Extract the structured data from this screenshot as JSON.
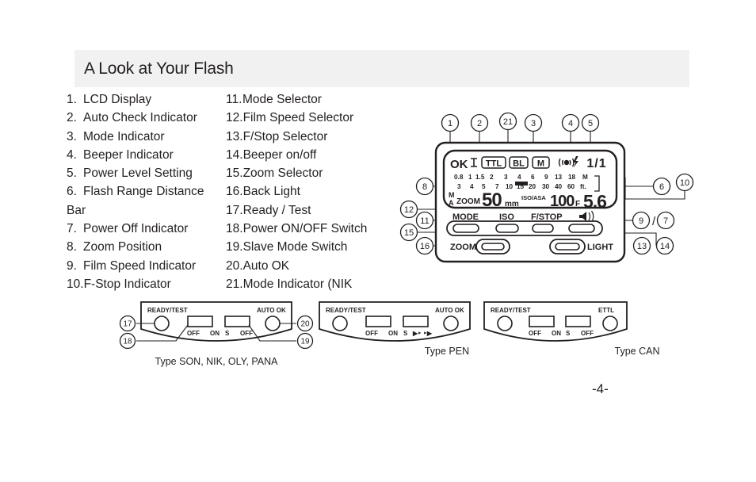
{
  "header": {
    "title": "A Look at Your Flash"
  },
  "page": {
    "number": "-4-"
  },
  "list_left": [
    {
      "num": "1.",
      "label": "LCD Display"
    },
    {
      "num": "2.",
      "label": "Auto Check Indicator"
    },
    {
      "num": "3.",
      "label": "Mode Indicator"
    },
    {
      "num": "4.",
      "label": "Beeper Indicator"
    },
    {
      "num": "5.",
      "label": "Power Level Setting"
    },
    {
      "num": "6.",
      "label": "Flash Range Distance"
    },
    {
      "num": "",
      "label": "Bar"
    },
    {
      "num": "7.",
      "label": "Power Off Indicator"
    },
    {
      "num": "8.",
      "label": "Zoom Position"
    },
    {
      "num": "9.",
      "label": "Film Speed Indicator"
    },
    {
      "num": "10.",
      "label": "F-Stop Indicator"
    }
  ],
  "list_right": [
    {
      "num": "11.",
      "label": "Mode Selector"
    },
    {
      "num": "12.",
      "label": "Film Speed Selector"
    },
    {
      "num": "13.",
      "label": "F/Stop Selector"
    },
    {
      "num": "14.",
      "label": "Beeper on/off"
    },
    {
      "num": "15.",
      "label": "Zoom Selector"
    },
    {
      "num": "16.",
      "label": "Back Light"
    },
    {
      "num": "17.",
      "label": "Ready / Test"
    },
    {
      "num": "18.",
      "label": "Power ON/OFF Switch"
    },
    {
      "num": "19.",
      "label": "Slave Mode Switch"
    },
    {
      "num": "20.",
      "label": "Auto OK"
    },
    {
      "num": "21.",
      "label": "Mode Indicator (NIK"
    }
  ],
  "flash_diagram": {
    "callouts_top": [
      "1",
      "2",
      "21",
      "3",
      "4",
      "5"
    ],
    "callouts_left": [
      "8",
      "12",
      "11",
      "15",
      "16"
    ],
    "callouts_right": [
      "6",
      "10",
      "9",
      "7",
      "13",
      "14"
    ],
    "callout_separator": "/",
    "lcd": {
      "ok_indicator": "OK",
      "power_off_icon": "power-off-bars",
      "modes": [
        "TTL",
        "BL",
        "M"
      ],
      "beeper_icon": "beeper-flash-icon",
      "power_level": "1/1",
      "distance_row_m": [
        "0.8",
        "1",
        "1.5",
        "2",
        "3",
        "4",
        "6",
        "9",
        "13",
        "18"
      ],
      "distance_unit_m": "M",
      "distance_row_ft": [
        "3",
        "4",
        "5",
        "7",
        "10",
        "15",
        "20",
        "30",
        "40",
        "60"
      ],
      "distance_unit_ft": "ft.",
      "zoom_mode_m": "M",
      "zoom_mode_a": "A",
      "zoom_label": "ZOOM",
      "zoom_value": "50",
      "zoom_unit": "mm",
      "iso_label": "ISO/ASA",
      "iso_value": "100",
      "fstop_label": "F",
      "fstop_value": "5.6"
    },
    "buttons_row1": [
      "MODE",
      "ISO",
      "F/STOP"
    ],
    "speaker_icon": "speaker-icon",
    "buttons_row2": [
      "ZOOM",
      "LIGHT"
    ]
  },
  "panels": [
    {
      "caption": "Type SON, NIK, OLY, PANA",
      "ready_label": "READY/TEST",
      "auto_label": "AUTO OK",
      "sw1_left": "OFF",
      "sw1_right": "ON",
      "sw2_left": "S",
      "sw2_right": "OFF",
      "callouts": [
        "17",
        "18",
        "20",
        "19"
      ]
    },
    {
      "caption": "Type PEN",
      "ready_label": "READY/TEST",
      "auto_label": "AUTO OK",
      "sw1_left": "OFF",
      "sw1_right": "ON",
      "sw2_left": "S",
      "sw2_right": "▶‣ ‣▶",
      "callouts": []
    },
    {
      "caption": "Type CAN",
      "ready_label": "READY/TEST",
      "auto_label": "ETTL",
      "sw1_left": "OFF",
      "sw1_right": "ON",
      "sw2_left": "S",
      "sw2_right": "OFF",
      "callouts": []
    }
  ],
  "colors": {
    "header_bg": "#f1f1f1",
    "text": "#231f20",
    "line": "#231f20",
    "page_bg": "#ffffff"
  }
}
